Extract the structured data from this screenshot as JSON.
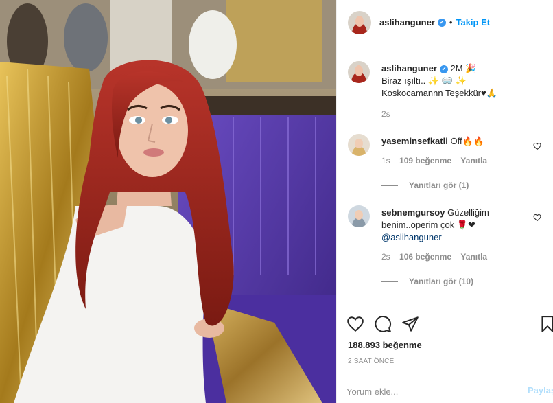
{
  "post": {
    "username": "aslihanguner",
    "follow_label": "Takip Et",
    "dot": "•",
    "verified_mark": "✔"
  },
  "caption": {
    "username": "aslihanguner",
    "text_line1_a": "2M 🎉",
    "text_line2": "Biraz ışıltı.. ✨ 🥽 ✨",
    "text_line3": "Koskocamannn Teşekkür♥🙏",
    "time": "2s"
  },
  "comments": [
    {
      "username": "yaseminsefkatli",
      "text": "Öff🔥🔥",
      "time": "1s",
      "likes": "109 beğenme",
      "reply": "Yanıtla",
      "view_replies": "Yanıtları gör (1)"
    },
    {
      "username": "sebnemgursoy",
      "text": "Güzelliğim benim..öperim çok 🌹❤",
      "mention": "@aslihanguner",
      "time": "2s",
      "likes": "106 beğenme",
      "reply": "Yanıtla",
      "view_replies": "Yanıtları gör (10)"
    }
  ],
  "stats": {
    "likes": "188.893 beğenme",
    "time": "2 SAAT ÖNCE"
  },
  "add_comment": {
    "placeholder": "Yorum ekle...",
    "post_label": "Paylaş"
  },
  "icons": {
    "like": "heart-outline-icon",
    "comment": "comment-bubble-icon",
    "share": "paper-plane-icon",
    "save": "bookmark-icon"
  },
  "colors": {
    "accent": "#0095f6",
    "verified": "#3897f0",
    "muted": "#8e8e8e",
    "text": "#262626",
    "hair": "#a8261c",
    "sofa": "#5b3ea8",
    "gold": "#c9a23a"
  }
}
